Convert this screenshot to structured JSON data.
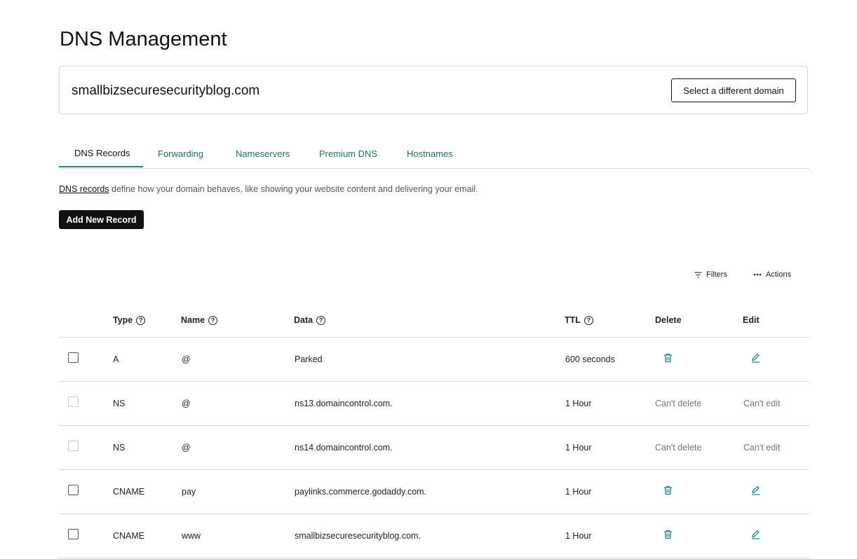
{
  "page": {
    "title": "DNS Management"
  },
  "domain": {
    "name": "smallbizsecuresecurityblog.com",
    "select_label": "Select a different domain"
  },
  "tabs": [
    {
      "label": "DNS Records"
    },
    {
      "label": "Forwarding"
    },
    {
      "label": "Nameservers"
    },
    {
      "label": "Premium DNS"
    },
    {
      "label": "Hostnames"
    }
  ],
  "description": {
    "link_text": "DNS records",
    "text": " define how your domain behaves, like showing your website content and delivering your email."
  },
  "add_button": "Add New Record",
  "toolbar": {
    "filters": "Filters",
    "actions": "Actions"
  },
  "table": {
    "headers": {
      "type": "Type",
      "name": "Name",
      "data": "Data",
      "ttl": "TTL",
      "delete": "Delete",
      "edit": "Edit"
    },
    "rows": [
      {
        "type": "A",
        "name": "@",
        "data": "Parked",
        "ttl": "600 seconds",
        "delete": "",
        "edit": "",
        "editable": true
      },
      {
        "type": "NS",
        "name": "@",
        "data": "ns13.domaincontrol.com.",
        "ttl": "1 Hour",
        "delete": "Can't delete",
        "edit": "Can't edit",
        "editable": false
      },
      {
        "type": "NS",
        "name": "@",
        "data": "ns14.domaincontrol.com.",
        "ttl": "1 Hour",
        "delete": "Can't delete",
        "edit": "Can't edit",
        "editable": false
      },
      {
        "type": "CNAME",
        "name": "pay",
        "data": "paylinks.commerce.godaddy.com.",
        "ttl": "1 Hour",
        "delete": "",
        "edit": "",
        "editable": true
      },
      {
        "type": "CNAME",
        "name": "www",
        "data": "smallbizsecuresecurityblog.com.",
        "ttl": "1 Hour",
        "delete": "",
        "edit": "",
        "editable": true
      }
    ]
  },
  "icons": {
    "delete": "trash-icon",
    "edit": "pencil-icon",
    "help": "question-circle-icon"
  },
  "colors": {
    "accent": "#1b8a83",
    "link": "#1b6f6a",
    "primary_button": "#111111"
  }
}
